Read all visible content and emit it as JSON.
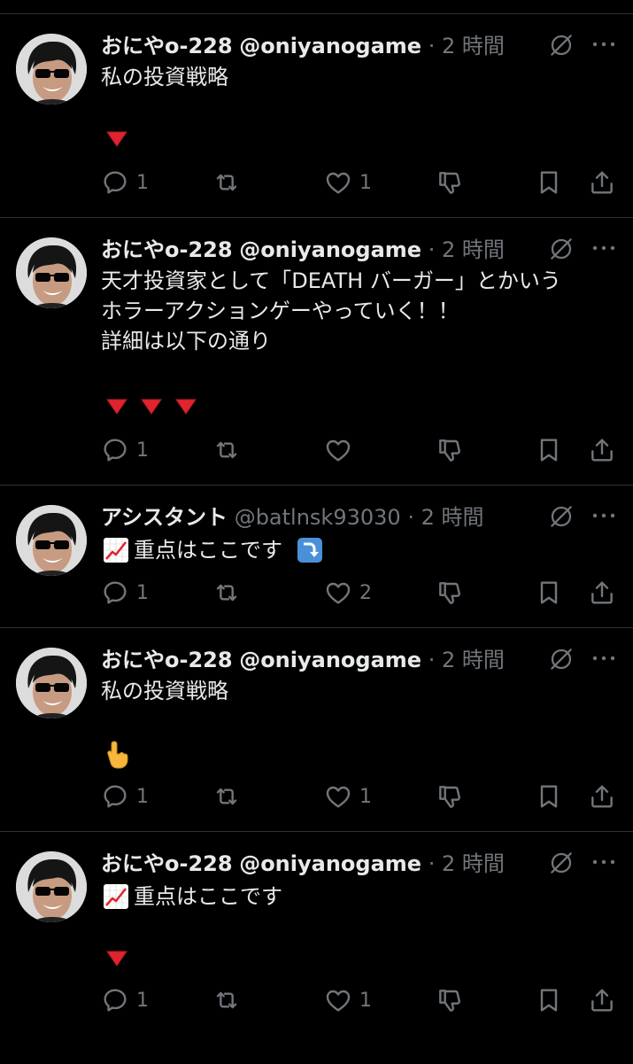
{
  "time_label": "2 時間",
  "tweets": [
    {
      "name": "おにやo-228",
      "handle": "@oniyanogame",
      "dot": "·",
      "time": "2 時間",
      "text": "私の投資戦略",
      "replies": "1",
      "retweets": "",
      "likes": "1"
    },
    {
      "name": "おにやo-228",
      "handle": "@oniyanogame",
      "dot": "·",
      "time": "2 時間",
      "text": "天才投資家として「DEATH バーガー」とかいう\nホラーアクションゲーやっていく！！\n詳細は以下の通り",
      "replies": "1",
      "retweets": "",
      "likes": ""
    },
    {
      "name": "アシスタント",
      "handle": "@batlnsk93030",
      "dot": "·",
      "time": "2 時間",
      "text": "重点はここです",
      "replies": "1",
      "retweets": "",
      "likes": "2"
    },
    {
      "name": "おにやo-228",
      "handle": "@oniyanogame",
      "dot": "·",
      "time": "2 時間",
      "text": "私の投資戦略",
      "replies": "1",
      "retweets": "",
      "likes": "1"
    },
    {
      "name": "おにやo-228",
      "handle": "@oniyanogame",
      "dot": "·",
      "time": "2 時間",
      "text": "重点はここです",
      "replies": "1",
      "retweets": "",
      "likes": "1"
    }
  ],
  "icons": [
    "reply-icon",
    "retweet-icon",
    "like-icon",
    "dislike-icon",
    "bookmark-icon",
    "share-icon",
    "grok-icon",
    "more-icon",
    "chart-emoji",
    "red-triangle-emoji",
    "pointing-down-emoji",
    "arrow-down-emoji"
  ],
  "colors": {
    "background": "#000000",
    "text": "#e7e9ea",
    "secondary": "#71767b",
    "divider": "#2f3336",
    "red_triangle": "#e0242f"
  }
}
